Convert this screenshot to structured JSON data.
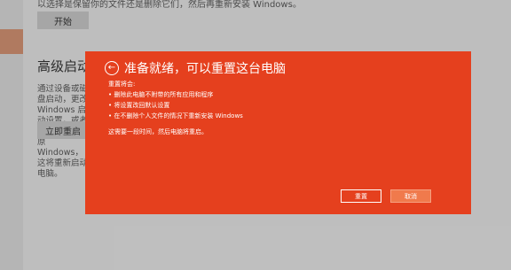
{
  "background": {
    "top_text": "以选择是保留你的文件还是删除它们，然后再重新安装 Windows。",
    "start_button": "开始",
    "section_heading": "高级启动",
    "section_desc": "通过设备或磁盘启动，更改 Windows 启动设置，或者从系统映像还原 Windows，这将重新启动电脑。",
    "restart_button": "立即重启"
  },
  "dialog": {
    "title": "准备就绪，可以重置这台电脑",
    "intro": "重置将会:",
    "bullets": [
      "删除此电脑不附带的所有应用和程序",
      "将设置改回默认设置",
      "在不删除个人文件的情况下重新安装 Windows"
    ],
    "note": "这需要一段时间，然后电脑将重启。",
    "refresh_button": "重置",
    "cancel_button": "取消",
    "accent_color": "#e5401e"
  }
}
